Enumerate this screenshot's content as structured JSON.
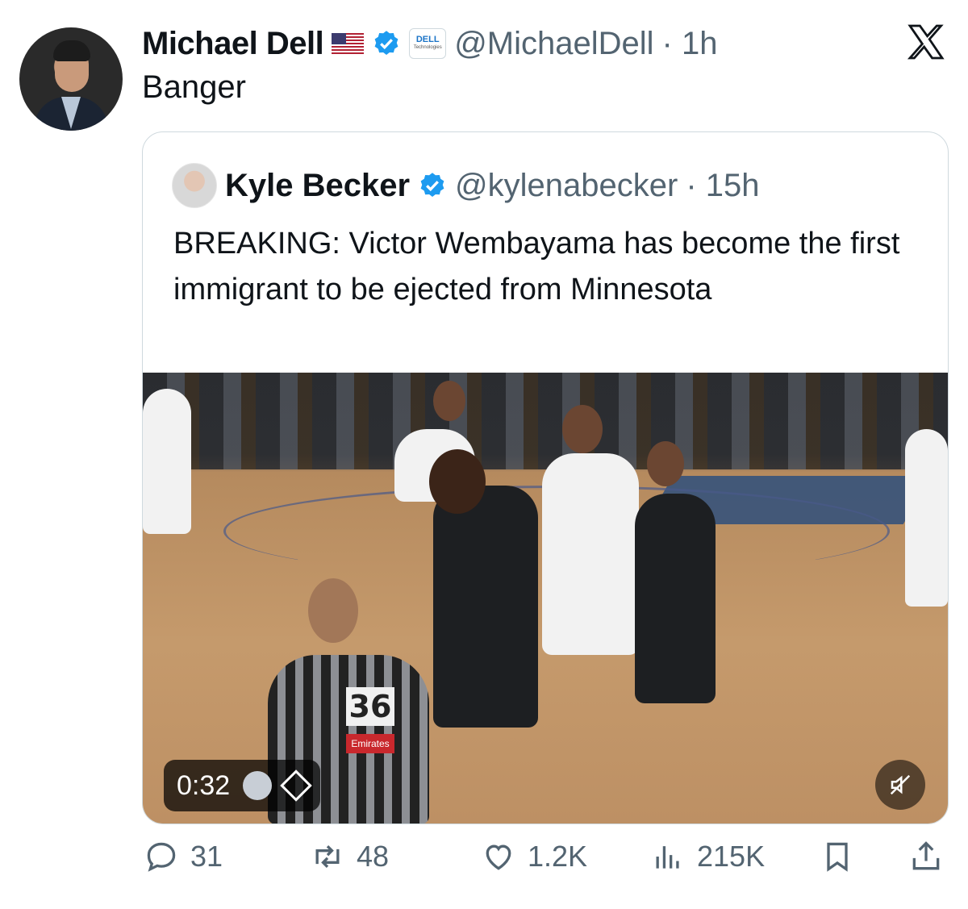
{
  "tweet": {
    "author": {
      "name": "Michael Dell",
      "flag_icon": "us-flag-icon",
      "verified_icon": "verified-badge-icon",
      "affiliate_badge": {
        "title": "DELL",
        "subtitle": "Technologies"
      },
      "handle": "@MichaelDell",
      "time": "· 1h"
    },
    "text": "Banger",
    "platform_icon": "x-logo-icon"
  },
  "quoted_tweet": {
    "author": {
      "name": "Kyle Becker",
      "verified_icon": "verified-badge-icon",
      "handle": "@kylenabecker",
      "time": "· 15h"
    },
    "text": "BREAKING: Victor Wembayama has become the first immigrant to be ejected from Minnesota",
    "video": {
      "duration": "0:32",
      "mute_icon": "muted-speaker-icon",
      "referee_number": "36",
      "referee_patch": "Emirates"
    }
  },
  "actions": {
    "replies": "31",
    "reposts": "48",
    "likes": "1.2K",
    "views": "215K"
  },
  "colors": {
    "text": "#0f1419",
    "secondary": "#536471",
    "border": "#cfd9de",
    "verified": "#1d9bf0"
  }
}
